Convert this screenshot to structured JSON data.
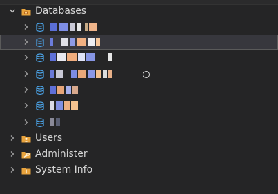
{
  "tree": {
    "databases": {
      "label": "Databases",
      "icon": "database-folder-icon",
      "expanded": true
    },
    "database_items": [
      {
        "icon": "database-icon",
        "name_redacted": true,
        "selected": false
      },
      {
        "icon": "database-icon",
        "name_redacted": true,
        "selected": true
      },
      {
        "icon": "database-icon",
        "name_redacted": true,
        "selected": false
      },
      {
        "icon": "database-icon",
        "name_redacted": true,
        "selected": false
      },
      {
        "icon": "database-icon",
        "name_redacted": true,
        "selected": false
      },
      {
        "icon": "database-icon",
        "name_redacted": true,
        "selected": false
      },
      {
        "icon": "database-icon",
        "name_redacted": true,
        "selected": false
      }
    ],
    "users": {
      "label": "Users",
      "icon": "users-folder-icon"
    },
    "administer": {
      "label": "Administer",
      "icon": "administer-folder-icon"
    },
    "system_info": {
      "label": "System Info",
      "icon": "system-info-folder-icon"
    }
  },
  "colors": {
    "background": "#252526",
    "selected_row": "#37373d",
    "folder_orange": "#e8a33d",
    "database_blue": "#4a9fe0",
    "text": "#d4d4d4"
  }
}
